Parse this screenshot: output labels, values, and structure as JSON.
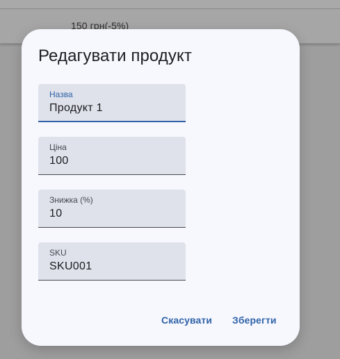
{
  "background": {
    "row_text": "150 грн(-5%)"
  },
  "dialog": {
    "title": "Редагувати продукт",
    "fields": [
      {
        "label": "Назва",
        "value": "Продукт 1",
        "focused": true
      },
      {
        "label": "Ціна",
        "value": "100"
      },
      {
        "label": "Знижка (%)",
        "value": "10"
      },
      {
        "label": "SKU",
        "value": "SKU001"
      }
    ],
    "actions": {
      "cancel_label": "Скасувати",
      "save_label": "Зберегти"
    }
  },
  "colors": {
    "accent": "#2f62a8",
    "field_bg": "#dfe2eb",
    "dialog_bg": "#f7f8fd",
    "scrim": "#9e9e9f"
  }
}
